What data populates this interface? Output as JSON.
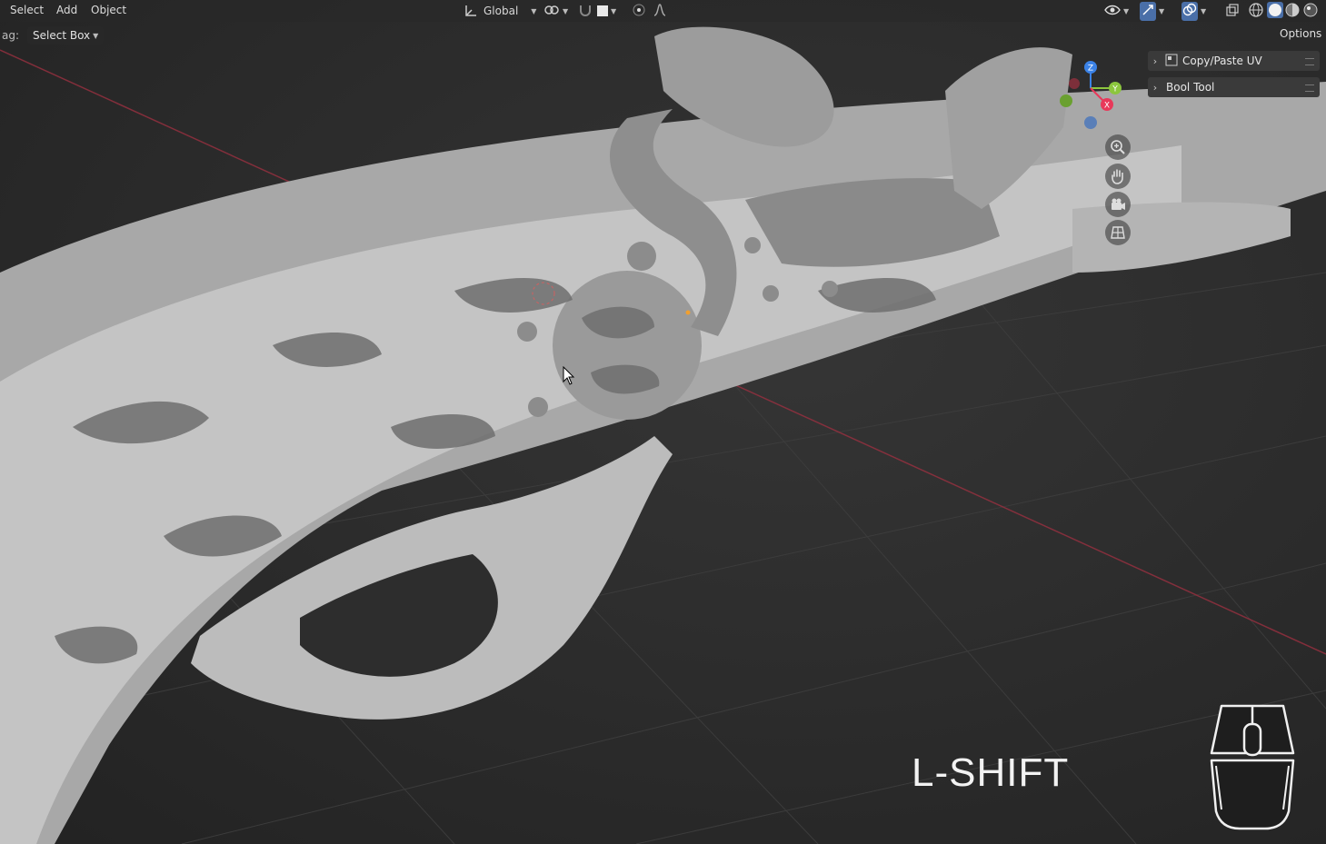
{
  "header": {
    "menus": [
      "Select",
      "Add",
      "Object"
    ],
    "transform_orientation": "Global"
  },
  "tool_settings": {
    "drag_label": "ag:",
    "drag_mode": "Select Box",
    "options_label": "Options"
  },
  "sidebar": {
    "items": [
      {
        "label": "Copy/Paste UV"
      },
      {
        "label": "Bool Tool"
      }
    ]
  },
  "gizmo": {
    "axes": {
      "z": "Z",
      "y": "Y",
      "x": "X"
    },
    "colors": {
      "x": "#e8395a",
      "y": "#8cc63e",
      "z": "#3b82e6"
    },
    "nav_icons": [
      "zoom-icon",
      "pan-hand-icon",
      "camera-icon",
      "ortho-grid-icon"
    ]
  },
  "overlay": {
    "key_pressed": "L-SHIFT"
  },
  "colors": {
    "viewport_bg": "#2b2b2b",
    "grid_line": "#3a3a3a",
    "x_axis_line": "#b03545",
    "model_light": "#bdbdbd",
    "model_dark": "#6f6f6f"
  }
}
